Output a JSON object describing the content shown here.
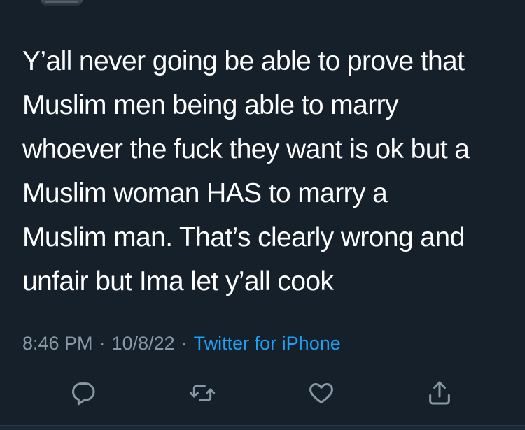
{
  "tweet": {
    "text": "Y’all never going be able to prove that\nMuslim men being able to marry\nwhoever the fuck they want is ok but a\nMuslim woman HAS to marry a\nMuslim man. That’s clearly wrong and\nunfair but Ima let y’all cook",
    "time": "8:46 PM",
    "date": "10/8/22",
    "source": "Twitter for iPhone",
    "separator": "·"
  },
  "actions": [
    {
      "name": "reply",
      "icon": "reply-icon"
    },
    {
      "name": "retweet",
      "icon": "retweet-icon"
    },
    {
      "name": "like",
      "icon": "heart-icon"
    },
    {
      "name": "share",
      "icon": "share-icon"
    }
  ],
  "colors": {
    "background": "#15202b",
    "text": "#ffffff",
    "secondary_text": "#8899a6",
    "link": "#1da1f2",
    "icon": "#8899a6"
  }
}
